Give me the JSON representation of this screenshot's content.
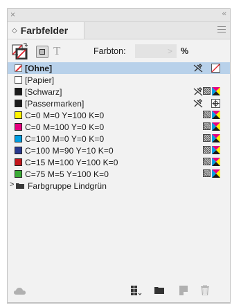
{
  "panel": {
    "title": "Farbfelder",
    "close_glyph": "×",
    "collapse_glyph": "‹‹",
    "tab_arrows": "◇"
  },
  "toolbar": {
    "t_label": "T",
    "farbton_label": "Farbton:",
    "farbton_value": "",
    "farbton_arrow": ">",
    "percent": "%"
  },
  "swatches": [
    {
      "label": "[Ohne]",
      "chip": "none",
      "selected": true
    },
    {
      "label": "[Papier]",
      "chip": "paper"
    },
    {
      "label": "[Schwarz]",
      "chip": "#1a1a1a"
    },
    {
      "label": "[Passermarken]",
      "chip": "#1a1a1a"
    },
    {
      "label": "C=0 M=0 Y=100 K=0",
      "chip": "#fff200"
    },
    {
      "label": "C=0 M=100 Y=0 K=0",
      "chip": "#e5007e"
    },
    {
      "label": "C=100 M=0 Y=0 K=0",
      "chip": "#009fe3"
    },
    {
      "label": "C=100 M=90 Y=10 K=0",
      "chip": "#2a3a8f"
    },
    {
      "label": "C=15 M=100 Y=100 K=0",
      "chip": "#c4161c"
    },
    {
      "label": "C=75 M=5 Y=100 K=0",
      "chip": "#3aaa35"
    }
  ],
  "group": {
    "label": "Farbgruppe Lindgrün",
    "caret": ">"
  },
  "colors": {
    "selected_row": "#b8d1ea",
    "ohne_red": "#e0262f"
  }
}
